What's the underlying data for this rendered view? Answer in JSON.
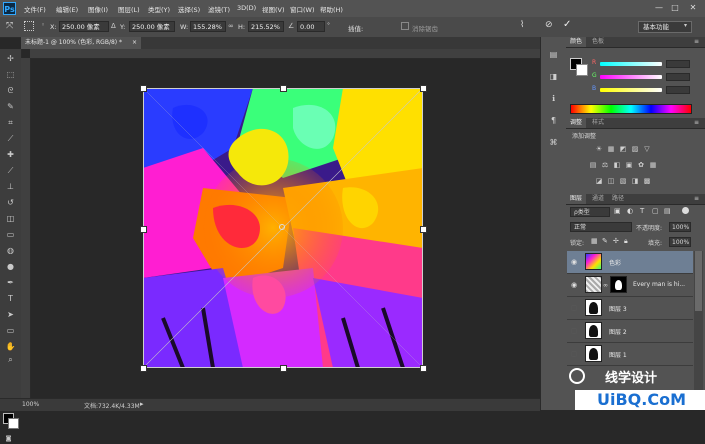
{
  "app": {
    "logo": "Ps",
    "window_controls": [
      "—",
      "□",
      "✕"
    ]
  },
  "menu": [
    "文件(F)",
    "编辑(E)",
    "图像(I)",
    "图层(L)",
    "类型(Y)",
    "选择(S)",
    "滤镜(T)",
    "3D(D)",
    "视图(V)",
    "窗口(W)",
    "帮助(H)"
  ],
  "options_bar": {
    "x_label": "X:",
    "x_value": "250.00 像素",
    "y_label": "Y:",
    "y_value": "250.00 像素",
    "w_label": "W:",
    "w_value": "155.28%",
    "h_label": "H:",
    "h_value": "215.52%",
    "angle_value": "0.00",
    "interp_label": "插值:",
    "anti_alias_label": "消除锯齿",
    "workspace": "基本功能"
  },
  "document_tab": {
    "title": "未标题-1 @ 100% (色彩, RGB/8) *",
    "close": "×"
  },
  "status_bar": {
    "zoom": "100%",
    "doc_info": "文档:732.4K/4.33M"
  },
  "color_panel": {
    "tabs": [
      "颜色",
      "色板"
    ],
    "channels": [
      {
        "label": "R",
        "color": "#ff3c3c",
        "gradient": "linear-gradient(to right,#00ffff,#ffffff)"
      },
      {
        "label": "G",
        "color": "#3cff3c",
        "gradient": "linear-gradient(to right,#ff00ff,#ffffff)"
      },
      {
        "label": "B",
        "color": "#3c7cff",
        "gradient": "linear-gradient(to right,#ffff00,#ffffff)"
      }
    ]
  },
  "adjustments_panel": {
    "tabs": [
      "调整",
      "样式"
    ],
    "subtitle": "添加调整",
    "rows": [
      [
        "☀",
        "▦",
        "◩",
        "▨",
        "▽"
      ],
      [
        "▤",
        "⚖",
        "◧",
        "▣",
        "✿",
        "▦"
      ],
      [
        "◪",
        "◫",
        "▧",
        "◨",
        "▩"
      ]
    ]
  },
  "layers_panel": {
    "tabs": [
      "图层",
      "通道",
      "路径"
    ],
    "filter_label": "ρ类型",
    "blend_mode": "正常",
    "opacity_label": "不透明度:",
    "opacity_value": "100%",
    "lock_label": "锁定:",
    "fill_label": "填充:",
    "fill_value": "100%",
    "layers": [
      {
        "name": "色彩",
        "selected": true
      },
      {
        "name": "Every man is hi...",
        "selected": false
      },
      {
        "name": "图层 3",
        "selected": false
      },
      {
        "name": "图层 2",
        "selected": false
      },
      {
        "name": "图层 1",
        "selected": false
      }
    ]
  },
  "watermark": {
    "logo": "UiBQ.CoM",
    "cn": "线学设计"
  }
}
